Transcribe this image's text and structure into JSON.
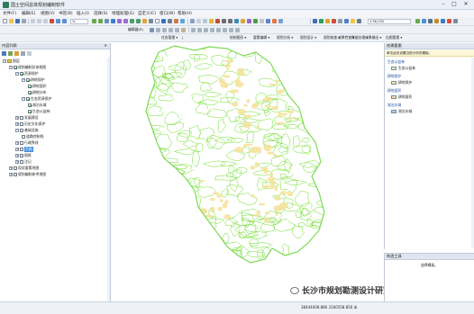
{
  "window": {
    "title": "国土空间总体规划编制软件",
    "min_glyph": "–",
    "max_glyph": "□",
    "close_glyph": "✕"
  },
  "menu": [
    "文件(F)",
    "编辑(E)",
    "视图(V)",
    "书签(B)",
    "插入(I)",
    "选择(S)",
    "地理处理(G)",
    "自定义(C)",
    "窗口(W)",
    "帮助(H)"
  ],
  "toolbar": {
    "scale_value": "1:56,035",
    "zoom_value": "%",
    "editor_label": "编辑器(R)",
    "row3_items": [
      "任务管理 ▾",
      "绘制图形 ▾",
      "要素编辑 ▾",
      "规划分析 ▾",
      "规划设计 ▾",
      "规划核查 ▾",
      "成果检查 ▾",
      "数据处理 ▾",
      "成果输出 ▾",
      "出图管理 ▾"
    ]
  },
  "toc": {
    "title": "内容列表",
    "close_glyph": "✕",
    "rows": [
      {
        "label": "图层",
        "indent": 0,
        "expander": "−",
        "checkbox": null,
        "swatch": null
      },
      {
        "label": "规划编制总体框图",
        "indent": 1,
        "expander": "−",
        "checkbox": true,
        "swatch": null
      },
      {
        "label": "资源保护",
        "indent": 2,
        "expander": "−",
        "checkbox": true,
        "swatch": null
      },
      {
        "label": "耕地保护",
        "indent": 3,
        "expander": "−",
        "checkbox": true,
        "swatch": null
      },
      {
        "label": "耕地面积",
        "indent": 4,
        "expander": null,
        "checkbox": true,
        "swatch": null
      },
      {
        "label": "耕地分布",
        "indent": 4,
        "expander": null,
        "checkbox": true,
        "swatch": null
      },
      {
        "label": "生态资源保护",
        "indent": 3,
        "expander": "−",
        "checkbox": true,
        "swatch": null
      },
      {
        "label": "湖泊水域",
        "indent": 4,
        "expander": null,
        "checkbox": true,
        "swatch": null
      },
      {
        "label": "生态公益林",
        "indent": 4,
        "expander": null,
        "checkbox": true,
        "swatch": null
      },
      {
        "label": "发展建设",
        "indent": 2,
        "expander": "+",
        "checkbox": false,
        "swatch": null
      },
      {
        "label": "历史文化保护",
        "indent": 2,
        "expander": "+",
        "checkbox": false,
        "swatch": null
      },
      {
        "label": "基础设施",
        "indent": 2,
        "expander": "−",
        "checkbox": false,
        "swatch": null
      },
      {
        "label": "道路控制线",
        "indent": 3,
        "expander": null,
        "checkbox": false,
        "swatch": null
      },
      {
        "label": "行政界线",
        "indent": 2,
        "expander": "+",
        "checkbox": false,
        "swatch": null
      },
      {
        "label": "范围",
        "indent": 2,
        "expander": "+",
        "checkbox": false,
        "swatch": null,
        "selected": true
      },
      {
        "label": "图框",
        "indent": 2,
        "expander": "+",
        "checkbox": false,
        "swatch": null
      },
      {
        "label": "注记",
        "indent": 2,
        "expander": "+",
        "checkbox": false,
        "swatch": null
      },
      {
        "label": "现状要素地图",
        "indent": 1,
        "expander": "+",
        "checkbox": false,
        "swatch": null
      },
      {
        "label": "规划编制参考地图",
        "indent": 1,
        "expander": "+",
        "checkbox": false,
        "swatch": null
      }
    ]
  },
  "templates": {
    "title": "创建要素",
    "hint": "单击此处设置当前分析的模板。",
    "groups": [
      {
        "heading": "生态公益林",
        "items": [
          {
            "label": "生态公益林",
            "color": "#d6f0c0"
          }
        ]
      },
      {
        "heading": "耕地保护",
        "items": [
          {
            "label": "耕地保护",
            "color": "#f7e89a"
          }
        ]
      },
      {
        "heading": "耕地面积",
        "items": [
          {
            "label": "耕地面积",
            "color": "#f3de8a"
          }
        ]
      },
      {
        "heading": "湖泊水域",
        "items": [
          {
            "label": "湖泊水域",
            "color": "#9fd3ef"
          }
        ]
      }
    ]
  },
  "construct": {
    "title": "构造工具",
    "hint": "选择模板。"
  },
  "status": {
    "coords": "38444008.886  3160558.856 米"
  },
  "watermark": {
    "text": "长沙市规划勘测设计研究院"
  },
  "colors": {
    "contour_green": "#6fdc2a",
    "farmland_yellow": "#f5e29a",
    "selection_blue": "#3d8ee0"
  }
}
